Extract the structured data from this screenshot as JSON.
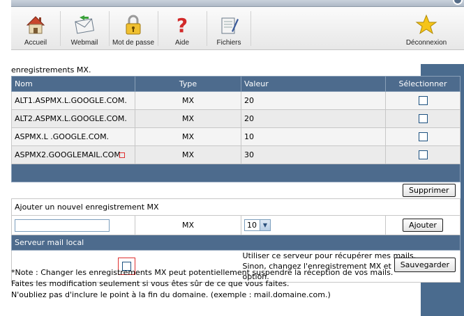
{
  "toolbar": {
    "items": [
      {
        "label": "Accueil",
        "icon": "home-icon"
      },
      {
        "label": "Webmail",
        "icon": "webmail-icon"
      },
      {
        "label": "Mot de passe",
        "icon": "lock-icon"
      },
      {
        "label": "Aide",
        "icon": "help-icon"
      },
      {
        "label": "Fichiers",
        "icon": "files-icon"
      },
      {
        "label": "Déconnexion",
        "icon": "star-icon"
      }
    ]
  },
  "intro": "enregistrements MX.",
  "table": {
    "headers": [
      "Nom",
      "Type",
      "Valeur",
      "Sélectionner"
    ],
    "rows": [
      {
        "name": "ALT1.ASPMX.L.GOOGLE.COM.",
        "type": "MX",
        "value": "20",
        "selected": false
      },
      {
        "name": "ALT2.ASPMX.L.GOOGLE.COM.",
        "type": "MX",
        "value": "20",
        "selected": false
      },
      {
        "name": "ASPMX.L .GOOGLE.COM.",
        "type": "MX",
        "value": "10",
        "selected": false
      },
      {
        "name": "ASPMX2.GOOGLEMAIL.COM",
        "type": "MX",
        "value": "30",
        "selected": false
      }
    ],
    "delete_label": "Supprimer"
  },
  "add": {
    "title": "Ajouter un nouvel enregistrement MX",
    "name_value": "",
    "type": "MX",
    "priority": "10",
    "add_label": "Ajouter"
  },
  "local": {
    "title": "Serveur mail local",
    "use_local": false,
    "line1": "Utiliser ce serveur pour récupérer mes mails.",
    "line2": "Sinon, changez l'enregistrement MX et décochez cette option.",
    "save_label": "Sauvegarder"
  },
  "notes": [
    "*Note : Changer les enregistrements MX peut potentiellement suspendre la réception de vos mails.",
    "Faites les modification seulement si vous êtes sûr de ce que vous faites.",
    "N'oubliez pas d'inclure le point à la fin du domaine. (exemple : mail.domaine.com.)"
  ],
  "colors": {
    "header_bar": "#4d6b8d",
    "side_panel": "#4a6b8e",
    "highlight": "#e03030"
  }
}
